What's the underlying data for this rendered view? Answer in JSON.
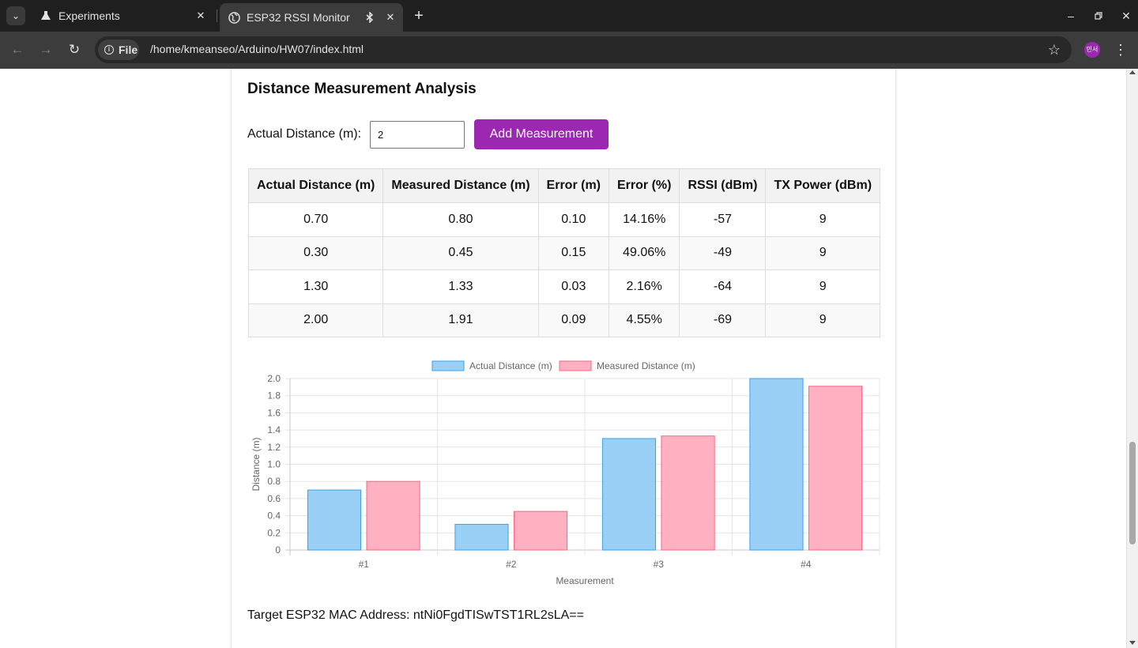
{
  "browser": {
    "tabs": [
      {
        "title": "Experiments",
        "icon": "flask-icon"
      },
      {
        "title": "ESP32 RSSI Monitor",
        "icon": "globe-icon",
        "active": true
      }
    ],
    "address": {
      "chip_label": "File",
      "url": "/home/kmeanseo/Arduino/HW07/index.html"
    },
    "profile_initials": "민서"
  },
  "page": {
    "section_title": "Distance Measurement Analysis",
    "form": {
      "label": "Actual Distance (m):",
      "value": "2",
      "button_label": "Add Measurement"
    },
    "table": {
      "headers": [
        "Actual Distance (m)",
        "Measured Distance (m)",
        "Error (m)",
        "Error (%)",
        "RSSI (dBm)",
        "TX Power (dBm)"
      ],
      "rows": [
        [
          "0.70",
          "0.80",
          "0.10",
          "14.16%",
          "-57",
          "9"
        ],
        [
          "0.30",
          "0.45",
          "0.15",
          "49.06%",
          "-49",
          "9"
        ],
        [
          "1.30",
          "1.33",
          "0.03",
          "2.16%",
          "-64",
          "9"
        ],
        [
          "2.00",
          "1.91",
          "0.09",
          "4.55%",
          "-69",
          "9"
        ]
      ]
    },
    "mac_line": "Target ESP32 MAC Address: ntNi0FgdTISwTST1RL2sLA=="
  },
  "chart_data": {
    "type": "bar",
    "categories": [
      "#1",
      "#2",
      "#3",
      "#4"
    ],
    "series": [
      {
        "name": "Actual Distance (m)",
        "values": [
          0.7,
          0.3,
          1.3,
          2.0
        ],
        "fill": "#9ad0f5",
        "stroke": "#36a2eb"
      },
      {
        "name": "Measured Distance (m)",
        "values": [
          0.8,
          0.45,
          1.33,
          1.91
        ],
        "fill": "#ffb1c1",
        "stroke": "#ff6384"
      }
    ],
    "xlabel": "Measurement",
    "ylabel": "Distance (m)",
    "ylim": [
      0,
      2.0
    ],
    "yticks": [
      "0",
      "0.2",
      "0.4",
      "0.6",
      "0.8",
      "1.0",
      "1.2",
      "1.4",
      "1.6",
      "1.8",
      "2.0"
    ],
    "legend": "top",
    "grid": true
  }
}
